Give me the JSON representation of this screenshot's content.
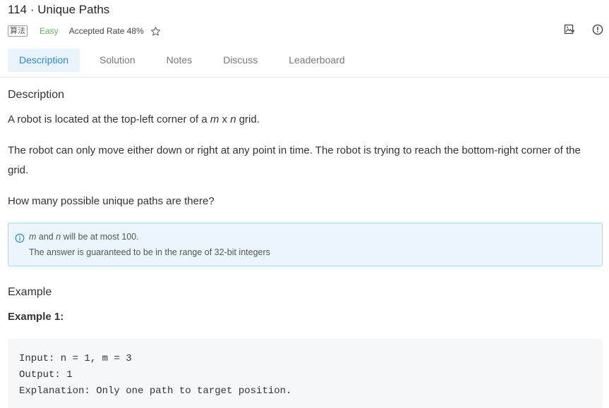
{
  "problem": {
    "title": "114 · Unique Paths",
    "tag": "算法",
    "difficulty": "Easy",
    "acceptance": "Accepted Rate 48%"
  },
  "icons": {
    "star": "star-outline-icon",
    "image": "image-icon",
    "info": "info-icon",
    "note_info": "info-icon"
  },
  "colors": {
    "accent": "#2e8bcf",
    "easy": "#5cb85c",
    "note_bg": "#eaf6fb",
    "note_border": "#9fd9ea",
    "tab_active_bg": "#e8f3fb",
    "code_bg": "#f6f7f9"
  },
  "tabs": [
    {
      "label": "Description",
      "active": true
    },
    {
      "label": "Solution",
      "active": false
    },
    {
      "label": "Notes",
      "active": false
    },
    {
      "label": "Discuss",
      "active": false
    },
    {
      "label": "Leaderboard",
      "active": false
    }
  ],
  "content": {
    "heading_description": "Description",
    "p1_before": "A robot is located at the top-left corner of a ",
    "p1_m": "m",
    "p1_x": " x ",
    "p1_n": "n",
    "p1_after": " grid.",
    "p2": "The robot can only move either down or right at any point in time. The robot is trying to reach the bottom-right corner of the grid.",
    "p3": "How many possible unique paths are there?",
    "note": {
      "line1_m": "m",
      "line1_and": " and ",
      "line1_n": "n",
      "line1_rest": " will be at most 100.",
      "line2": "The answer is guaranteed to be in the range of 32-bit integers"
    },
    "heading_example": "Example",
    "heading_example1": "Example 1:",
    "code_lines": [
      "Input: n = 1, m = 3",
      "Output: 1",
      "Explanation: Only one path to target position."
    ]
  }
}
